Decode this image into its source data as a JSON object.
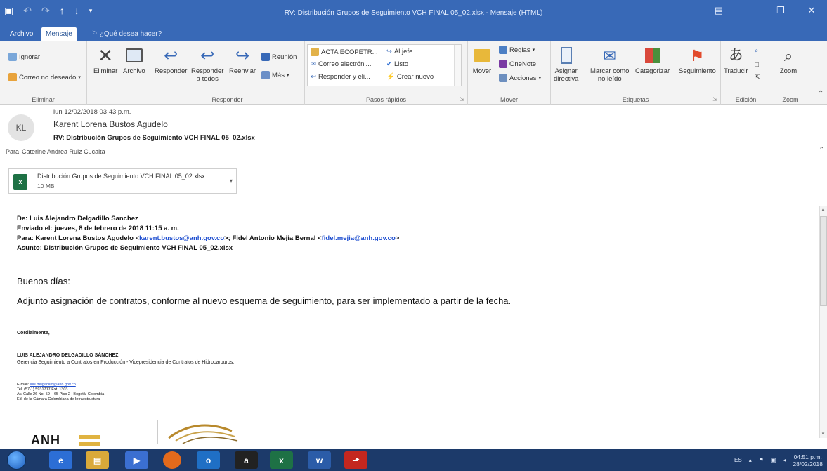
{
  "window": {
    "title": "RV: Distribución Grupos de Seguimiento VCH FINAL 05_02.xlsx - Mensaje (HTML)",
    "qat": [
      "save-icon",
      "undo-icon",
      "up-arrow-icon",
      "down-arrow-icon",
      "customize-icon"
    ]
  },
  "tabs": {
    "file": "Archivo",
    "message": "Mensaje",
    "tell_me": "¿Qué desea hacer?"
  },
  "ribbon": {
    "delete_group": {
      "label": "Eliminar",
      "ignore": "Ignorar",
      "junk": "Correo no deseado",
      "delete": "Eliminar",
      "archive": "Archivo"
    },
    "respond_group": {
      "label": "Responder",
      "reply": "Responder",
      "reply_all_1": "Responder",
      "reply_all_2": "a todos",
      "forward": "Reenviar",
      "meeting": "Reunión",
      "more": "Más"
    },
    "quick_steps": {
      "label": "Pasos rápidos",
      "items": [
        "ACTA ECOPETR...",
        "Al jefe",
        "Correo electróni...",
        "Listo",
        "Responder y eli...",
        "Crear nuevo"
      ]
    },
    "move_group": {
      "label": "Mover",
      "move": "Mover",
      "rules": "Reglas",
      "onenote": "OneNote",
      "actions": "Acciones"
    },
    "tags_group": {
      "label": "Etiquetas",
      "assign_1": "Asignar",
      "assign_2": "directiva",
      "unread_1": "Marcar como",
      "unread_2": "no leído",
      "categorize": "Categorizar",
      "followup": "Seguimiento"
    },
    "edit_group": {
      "label": "Edición",
      "translate": "Traducir"
    },
    "zoom_group": {
      "label": "Zoom",
      "zoom": "Zoom"
    }
  },
  "message": {
    "avatar_initials": "KL",
    "date": "lun 12/02/2018 03:43 p.m.",
    "from": "Karent Lorena Bustos Agudelo",
    "subject": "RV: Distribución Grupos de Seguimiento VCH FINAL 05_02.xlsx",
    "to_label": "Para",
    "to": "Caterine Andrea Ruiz Cucaita"
  },
  "attachment": {
    "name": "Distribución Grupos de Seguimiento VCH FINAL 05_02.xlsx",
    "size": "10 MB",
    "icon_letter": "x"
  },
  "body": {
    "fwd_from_k": "De:",
    "fwd_from": "Luis Alejandro Delgadillo Sanchez",
    "fwd_sent_k": "Enviado el:",
    "fwd_sent": "jueves, 8 de febrero de 2018 11:15 a. m.",
    "fwd_to_k": "Para:",
    "fwd_to_1": "Karent Lorena Bustos Agudelo <",
    "fwd_to_1_email": "karent.bustos@anh.gov.co",
    "fwd_to_2": ">; Fidel Antonio Mejia Bernal <",
    "fwd_to_2_email": "fidel.mejia@anh.gov.co",
    "fwd_to_end": ">",
    "fwd_subject_k": "Asunto:",
    "fwd_subject": "Distribución Grupos de Seguimiento VCH FINAL 05_02.xlsx",
    "greeting": "Buenos días:",
    "paragraph": "Adjunto asignación de contratos, conforme al nuevo esquema de seguimiento, para ser implementado a partir de la fecha.",
    "regards": "Cordialmente,",
    "sig_name": "LUIS ALEJANDRO DELGADILLO SÁNCHEZ",
    "sig_role": "Gerencia Seguimiento a Contratos en Producción - Vicepresidencia de Contratos de Hidrocarburos.",
    "email_k": "E-mail:",
    "email": "luis.delgadillo@anh.gov.co",
    "tel": "Tel: (57-1) 5931717 Ext. 1303",
    "address": "Av. Calle 26 No. 59 – 65 Piso 2 | Bogotá, Colombia",
    "building": "Ed. de la Cámara Colombiana de Infraestructura",
    "logo_text": "ANH"
  },
  "taskbar": {
    "apps": [
      "ie-icon",
      "explorer-icon",
      "media-icon",
      "firefox-icon",
      "outlook-icon",
      "amazon-icon",
      "excel-icon",
      "word-icon",
      "acrobat-icon"
    ],
    "lang": "ES",
    "time": "04:51 p.m.",
    "date": "28/02/2018"
  },
  "colors": {
    "titlebar": "#3869b7",
    "taskbar": "#1c3a6a",
    "link": "#1f4fd0"
  }
}
